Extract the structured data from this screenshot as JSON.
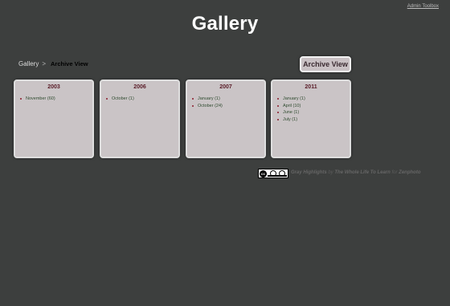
{
  "admin": {
    "label": "Admin Toolbox"
  },
  "header": {
    "title": "Gallery"
  },
  "breadcrumb": {
    "root": "Gallery",
    "separator": ">",
    "current": "Archive View"
  },
  "archive_button": {
    "label": "Archive View"
  },
  "years": [
    {
      "year": "2003",
      "months": [
        "November (60)"
      ]
    },
    {
      "year": "2006",
      "months": [
        "October (1)"
      ]
    },
    {
      "year": "2007",
      "months": [
        "January (1)",
        "October (24)"
      ]
    },
    {
      "year": "2011",
      "months": [
        "January (1)",
        "April (10)",
        "June (1)",
        "July (1)"
      ]
    }
  ],
  "footer": {
    "theme": "Gray Highlights",
    "by": "by",
    "author": "The Whole Life To Learn",
    "for": "for",
    "platform": "Zenphoto",
    "license_icon": "creative-commons-badge"
  }
}
